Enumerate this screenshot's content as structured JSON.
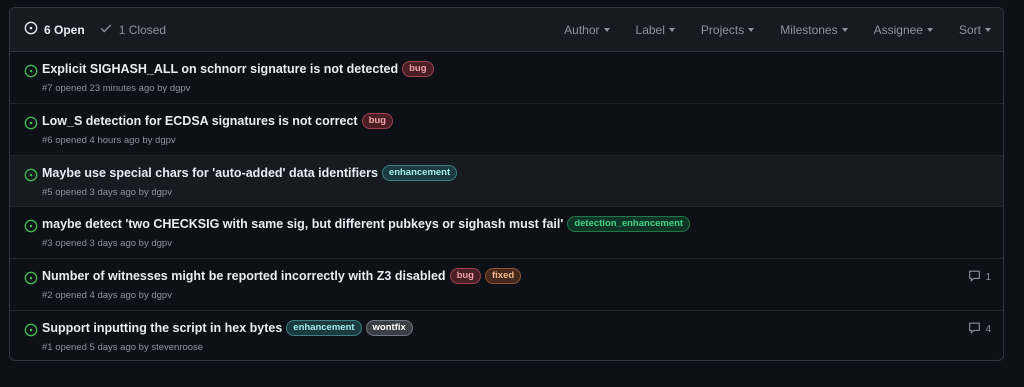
{
  "header": {
    "open_count": "6 Open",
    "closed_count": "1 Closed",
    "filters": [
      "Author",
      "Label",
      "Projects",
      "Milestones",
      "Assignee",
      "Sort"
    ]
  },
  "labels": {
    "bug": {
      "text": "bug",
      "fg": "#f0a0a8",
      "bg": "#4a1f24",
      "border": "#a1424f"
    },
    "enhancement": {
      "text": "enhancement",
      "fg": "#a2eeef",
      "bg": "#1b3a3f",
      "border": "#3e7e84"
    },
    "detection_enhancement": {
      "text": "detection_enhancement",
      "fg": "#3fd68a",
      "bg": "#0f3324",
      "border": "#1f7a4b"
    },
    "fixed": {
      "text": "fixed",
      "fg": "#f2b58d",
      "bg": "#45291a",
      "border": "#8e5637"
    },
    "wontfix": {
      "text": "wontfix",
      "fg": "#ffffff",
      "bg": "#3a3d41",
      "border": "#6e7681"
    }
  },
  "colors": {
    "open_icon": "#3fb950",
    "text": "#e6edf3",
    "muted": "#8b949e"
  },
  "issues": [
    {
      "title": "Explicit SIGHASH_ALL on schnorr signature is not detected",
      "labels": [
        "bug"
      ],
      "meta": "#7 opened 23 minutes ago by dgpv",
      "comments": ""
    },
    {
      "title": "Low_S detection for ECDSA signatures is not correct",
      "labels": [
        "bug"
      ],
      "meta": "#6 opened 4 hours ago by dgpv",
      "comments": ""
    },
    {
      "title": "Maybe use special chars for 'auto-added' data identifiers",
      "labels": [
        "enhancement"
      ],
      "meta": "#5 opened 3 days ago by dgpv",
      "comments": ""
    },
    {
      "title": "maybe detect 'two CHECKSIG with same sig, but different pubkeys or sighash must fail'",
      "labels": [
        "detection_enhancement"
      ],
      "meta": "#3 opened 3 days ago by dgpv",
      "comments": ""
    },
    {
      "title": "Number of witnesses might be reported incorrectly with Z3 disabled",
      "labels": [
        "bug",
        "fixed"
      ],
      "meta": "#2 opened 4 days ago by dgpv",
      "comments": "1"
    },
    {
      "title": "Support inputting the script in hex bytes",
      "labels": [
        "enhancement",
        "wontfix"
      ],
      "meta": "#1 opened 5 days ago by stevenroose",
      "comments": "4"
    }
  ]
}
